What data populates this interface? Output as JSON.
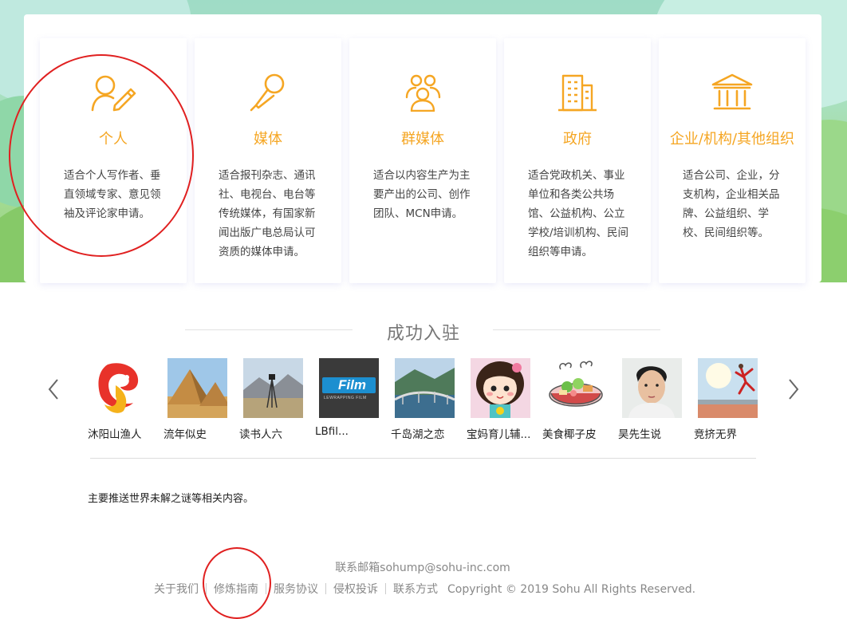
{
  "types": [
    {
      "title": "个人",
      "icon": "person-pen-icon",
      "desc": "适合个人写作者、垂直领域专家、意见领袖及评论家申请。"
    },
    {
      "title": "媒体",
      "icon": "microphone-icon",
      "desc": "适合报刊杂志、通讯社、电视台、电台等传统媒体，有国家新闻出版广电总局认可资质的媒体申请。"
    },
    {
      "title": "群媒体",
      "icon": "group-icon",
      "desc": "适合以内容生产为主要产出的公司、创作团队、MCN申请。"
    },
    {
      "title": "政府",
      "icon": "building-icon",
      "desc": "适合党政机关、事业单位和各类公共场馆、公益机构、公立学校/培训机构、民间组织等申请。"
    },
    {
      "title": "企业/机构/其他组织",
      "icon": "institution-icon",
      "desc": "适合公司、企业，分支机构，企业相关品牌、公益组织、学校、民间组织等。"
    }
  ],
  "success": {
    "title": "成功入驻",
    "entries": [
      {
        "name": "沐阳山渔人"
      },
      {
        "name": "流年似史"
      },
      {
        "name": "读书人六"
      },
      {
        "name": "LBfil..."
      },
      {
        "name": "千岛湖之恋"
      },
      {
        "name": "宝妈育儿辅..."
      },
      {
        "name": "美食椰子皮"
      },
      {
        "name": "昊先生说"
      },
      {
        "name": "竞挤无界"
      }
    ],
    "logo_text": "Film",
    "logo_subtext": "LEWRAPPING FILM",
    "intro": "主要推送世界未解之谜等相关内容。"
  },
  "colors": {
    "accent": "#f5a623",
    "annotation": "#e02020"
  },
  "footer": {
    "contact": "联系邮箱sohump@sohu-inc.com",
    "links": [
      "关于我们",
      "修炼指南",
      "服务协议",
      "侵权投诉",
      "联系方式"
    ],
    "copyright": "Copyright © 2019 Sohu All Rights Reserved."
  }
}
